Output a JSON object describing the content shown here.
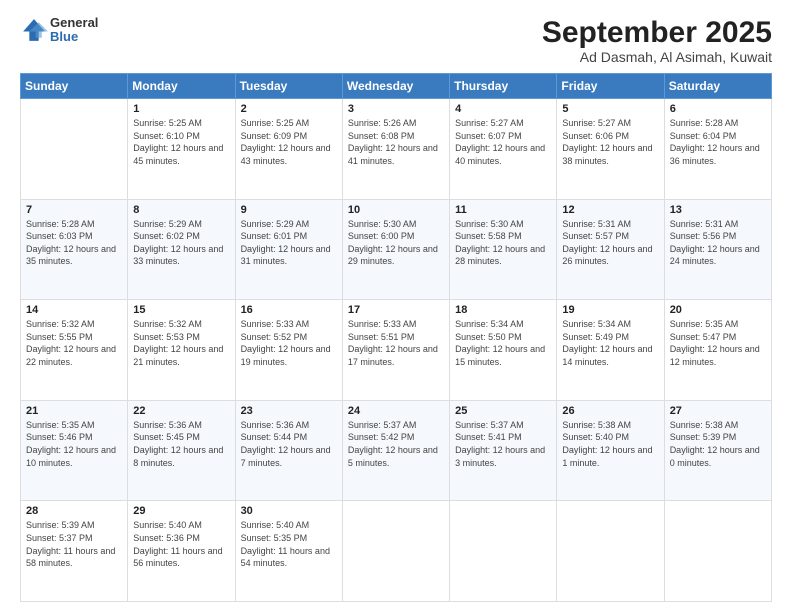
{
  "logo": {
    "general": "General",
    "blue": "Blue"
  },
  "header": {
    "month": "September 2025",
    "location": "Ad Dasmah, Al Asimah, Kuwait"
  },
  "weekdays": [
    "Sunday",
    "Monday",
    "Tuesday",
    "Wednesday",
    "Thursday",
    "Friday",
    "Saturday"
  ],
  "weeks": [
    [
      {
        "day": "",
        "sunrise": "",
        "sunset": "",
        "daylight": ""
      },
      {
        "day": "1",
        "sunrise": "Sunrise: 5:25 AM",
        "sunset": "Sunset: 6:10 PM",
        "daylight": "Daylight: 12 hours and 45 minutes."
      },
      {
        "day": "2",
        "sunrise": "Sunrise: 5:25 AM",
        "sunset": "Sunset: 6:09 PM",
        "daylight": "Daylight: 12 hours and 43 minutes."
      },
      {
        "day": "3",
        "sunrise": "Sunrise: 5:26 AM",
        "sunset": "Sunset: 6:08 PM",
        "daylight": "Daylight: 12 hours and 41 minutes."
      },
      {
        "day": "4",
        "sunrise": "Sunrise: 5:27 AM",
        "sunset": "Sunset: 6:07 PM",
        "daylight": "Daylight: 12 hours and 40 minutes."
      },
      {
        "day": "5",
        "sunrise": "Sunrise: 5:27 AM",
        "sunset": "Sunset: 6:06 PM",
        "daylight": "Daylight: 12 hours and 38 minutes."
      },
      {
        "day": "6",
        "sunrise": "Sunrise: 5:28 AM",
        "sunset": "Sunset: 6:04 PM",
        "daylight": "Daylight: 12 hours and 36 minutes."
      }
    ],
    [
      {
        "day": "7",
        "sunrise": "Sunrise: 5:28 AM",
        "sunset": "Sunset: 6:03 PM",
        "daylight": "Daylight: 12 hours and 35 minutes."
      },
      {
        "day": "8",
        "sunrise": "Sunrise: 5:29 AM",
        "sunset": "Sunset: 6:02 PM",
        "daylight": "Daylight: 12 hours and 33 minutes."
      },
      {
        "day": "9",
        "sunrise": "Sunrise: 5:29 AM",
        "sunset": "Sunset: 6:01 PM",
        "daylight": "Daylight: 12 hours and 31 minutes."
      },
      {
        "day": "10",
        "sunrise": "Sunrise: 5:30 AM",
        "sunset": "Sunset: 6:00 PM",
        "daylight": "Daylight: 12 hours and 29 minutes."
      },
      {
        "day": "11",
        "sunrise": "Sunrise: 5:30 AM",
        "sunset": "Sunset: 5:58 PM",
        "daylight": "Daylight: 12 hours and 28 minutes."
      },
      {
        "day": "12",
        "sunrise": "Sunrise: 5:31 AM",
        "sunset": "Sunset: 5:57 PM",
        "daylight": "Daylight: 12 hours and 26 minutes."
      },
      {
        "day": "13",
        "sunrise": "Sunrise: 5:31 AM",
        "sunset": "Sunset: 5:56 PM",
        "daylight": "Daylight: 12 hours and 24 minutes."
      }
    ],
    [
      {
        "day": "14",
        "sunrise": "Sunrise: 5:32 AM",
        "sunset": "Sunset: 5:55 PM",
        "daylight": "Daylight: 12 hours and 22 minutes."
      },
      {
        "day": "15",
        "sunrise": "Sunrise: 5:32 AM",
        "sunset": "Sunset: 5:53 PM",
        "daylight": "Daylight: 12 hours and 21 minutes."
      },
      {
        "day": "16",
        "sunrise": "Sunrise: 5:33 AM",
        "sunset": "Sunset: 5:52 PM",
        "daylight": "Daylight: 12 hours and 19 minutes."
      },
      {
        "day": "17",
        "sunrise": "Sunrise: 5:33 AM",
        "sunset": "Sunset: 5:51 PM",
        "daylight": "Daylight: 12 hours and 17 minutes."
      },
      {
        "day": "18",
        "sunrise": "Sunrise: 5:34 AM",
        "sunset": "Sunset: 5:50 PM",
        "daylight": "Daylight: 12 hours and 15 minutes."
      },
      {
        "day": "19",
        "sunrise": "Sunrise: 5:34 AM",
        "sunset": "Sunset: 5:49 PM",
        "daylight": "Daylight: 12 hours and 14 minutes."
      },
      {
        "day": "20",
        "sunrise": "Sunrise: 5:35 AM",
        "sunset": "Sunset: 5:47 PM",
        "daylight": "Daylight: 12 hours and 12 minutes."
      }
    ],
    [
      {
        "day": "21",
        "sunrise": "Sunrise: 5:35 AM",
        "sunset": "Sunset: 5:46 PM",
        "daylight": "Daylight: 12 hours and 10 minutes."
      },
      {
        "day": "22",
        "sunrise": "Sunrise: 5:36 AM",
        "sunset": "Sunset: 5:45 PM",
        "daylight": "Daylight: 12 hours and 8 minutes."
      },
      {
        "day": "23",
        "sunrise": "Sunrise: 5:36 AM",
        "sunset": "Sunset: 5:44 PM",
        "daylight": "Daylight: 12 hours and 7 minutes."
      },
      {
        "day": "24",
        "sunrise": "Sunrise: 5:37 AM",
        "sunset": "Sunset: 5:42 PM",
        "daylight": "Daylight: 12 hours and 5 minutes."
      },
      {
        "day": "25",
        "sunrise": "Sunrise: 5:37 AM",
        "sunset": "Sunset: 5:41 PM",
        "daylight": "Daylight: 12 hours and 3 minutes."
      },
      {
        "day": "26",
        "sunrise": "Sunrise: 5:38 AM",
        "sunset": "Sunset: 5:40 PM",
        "daylight": "Daylight: 12 hours and 1 minute."
      },
      {
        "day": "27",
        "sunrise": "Sunrise: 5:38 AM",
        "sunset": "Sunset: 5:39 PM",
        "daylight": "Daylight: 12 hours and 0 minutes."
      }
    ],
    [
      {
        "day": "28",
        "sunrise": "Sunrise: 5:39 AM",
        "sunset": "Sunset: 5:37 PM",
        "daylight": "Daylight: 11 hours and 58 minutes."
      },
      {
        "day": "29",
        "sunrise": "Sunrise: 5:40 AM",
        "sunset": "Sunset: 5:36 PM",
        "daylight": "Daylight: 11 hours and 56 minutes."
      },
      {
        "day": "30",
        "sunrise": "Sunrise: 5:40 AM",
        "sunset": "Sunset: 5:35 PM",
        "daylight": "Daylight: 11 hours and 54 minutes."
      },
      {
        "day": "",
        "sunrise": "",
        "sunset": "",
        "daylight": ""
      },
      {
        "day": "",
        "sunrise": "",
        "sunset": "",
        "daylight": ""
      },
      {
        "day": "",
        "sunrise": "",
        "sunset": "",
        "daylight": ""
      },
      {
        "day": "",
        "sunrise": "",
        "sunset": "",
        "daylight": ""
      }
    ]
  ]
}
